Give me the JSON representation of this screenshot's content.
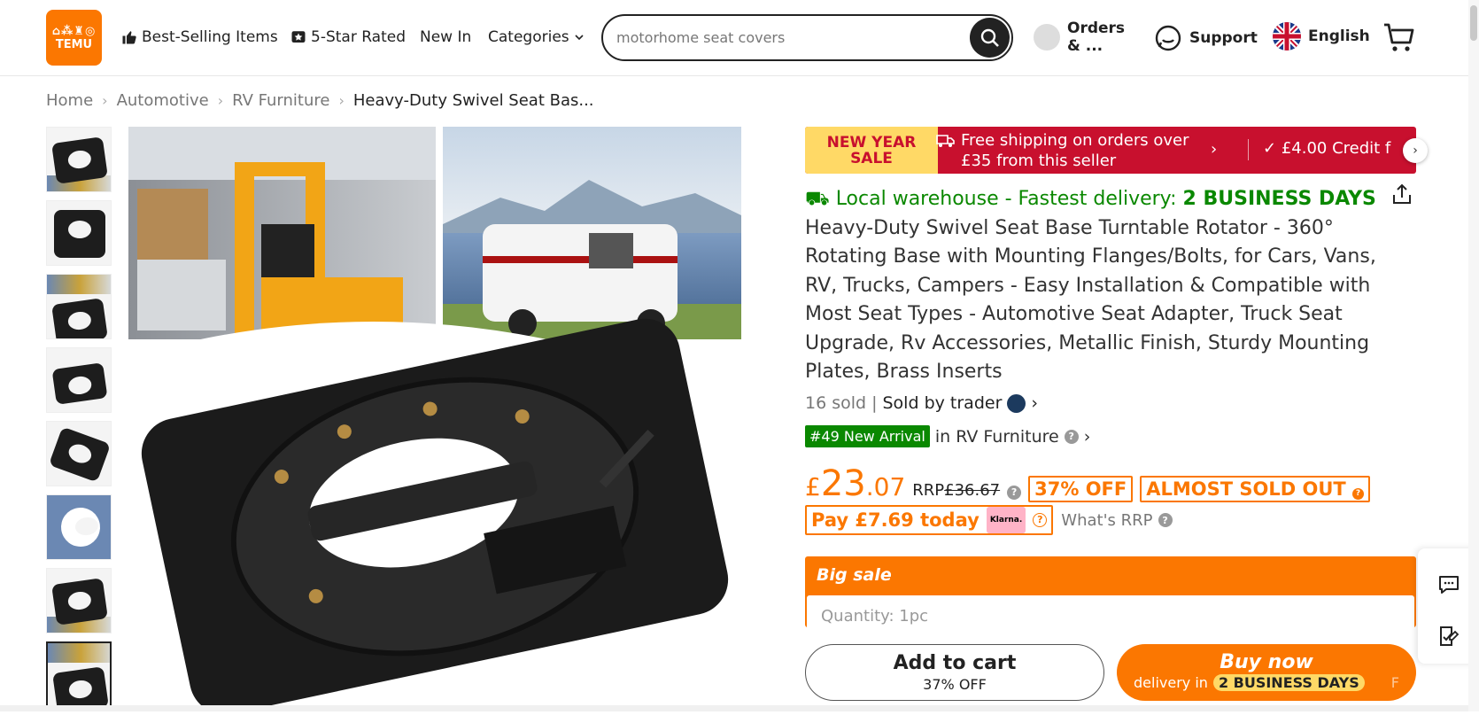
{
  "brand": {
    "logo_text": "TEMU",
    "logo_glyphs": "⌂⁂♜◎",
    "accent": "#fb7701"
  },
  "nav": {
    "best_selling": "Best-Selling Items",
    "five_star": "5-Star Rated",
    "new_in": "New In",
    "categories": "Categories"
  },
  "search": {
    "value": "motorhome seat covers"
  },
  "header": {
    "orders": "Orders & ...",
    "support": "Support",
    "language": "English"
  },
  "breadcrumb": [
    "Home",
    "Automotive",
    "RV Furniture",
    "Heavy-Duty Swivel Seat Bas..."
  ],
  "banner": {
    "sale_line1": "NEW YEAR",
    "sale_line2": "SALE",
    "shipping": "Free shipping on orders over £35 from this seller",
    "credit": "£4.00 Credit f"
  },
  "product": {
    "delivery_prefix": "Local warehouse - Fastest delivery:",
    "delivery_days": "2 BUSINESS DAYS",
    "title": "Heavy-Duty Swivel Seat Base Turntable Rotator - 360° Rotating Base with Mounting Flanges/Bolts, for Cars, Vans, RV, Trucks, Campers - Easy Installation & Compatible with Most Seat Types - Automotive Seat Adapter, Truck Seat Upgrade, Rv Accessories, Metallic Finish, Sturdy Mounting Plates, Brass Inserts",
    "sold_count": "16 sold",
    "sold_by": "Sold by trader",
    "rank_tag": "#49 New Arrival",
    "rank_in": "in RV Furniture"
  },
  "price": {
    "currency": "£",
    "whole": "23",
    "decimal": ".07",
    "rrp_label": "RRP",
    "rrp_value": "£36.67",
    "discount": "37% OFF",
    "almost_sold": "ALMOST SOLD OUT",
    "pay_today": "Pay £7.69 today",
    "klarna": "Klarna.",
    "whats_rrp": "What's RRP"
  },
  "sale_box": {
    "label": "Big sale",
    "quantity": "Quantity: 1pc"
  },
  "buttons": {
    "add_to_cart": "Add to cart",
    "add_to_cart_sub": "37% OFF",
    "buy_now": "Buy now",
    "buy_now_prefix": "delivery in",
    "buy_now_days": "2 BUSINESS DAYS",
    "buy_now_trailing": "F"
  }
}
